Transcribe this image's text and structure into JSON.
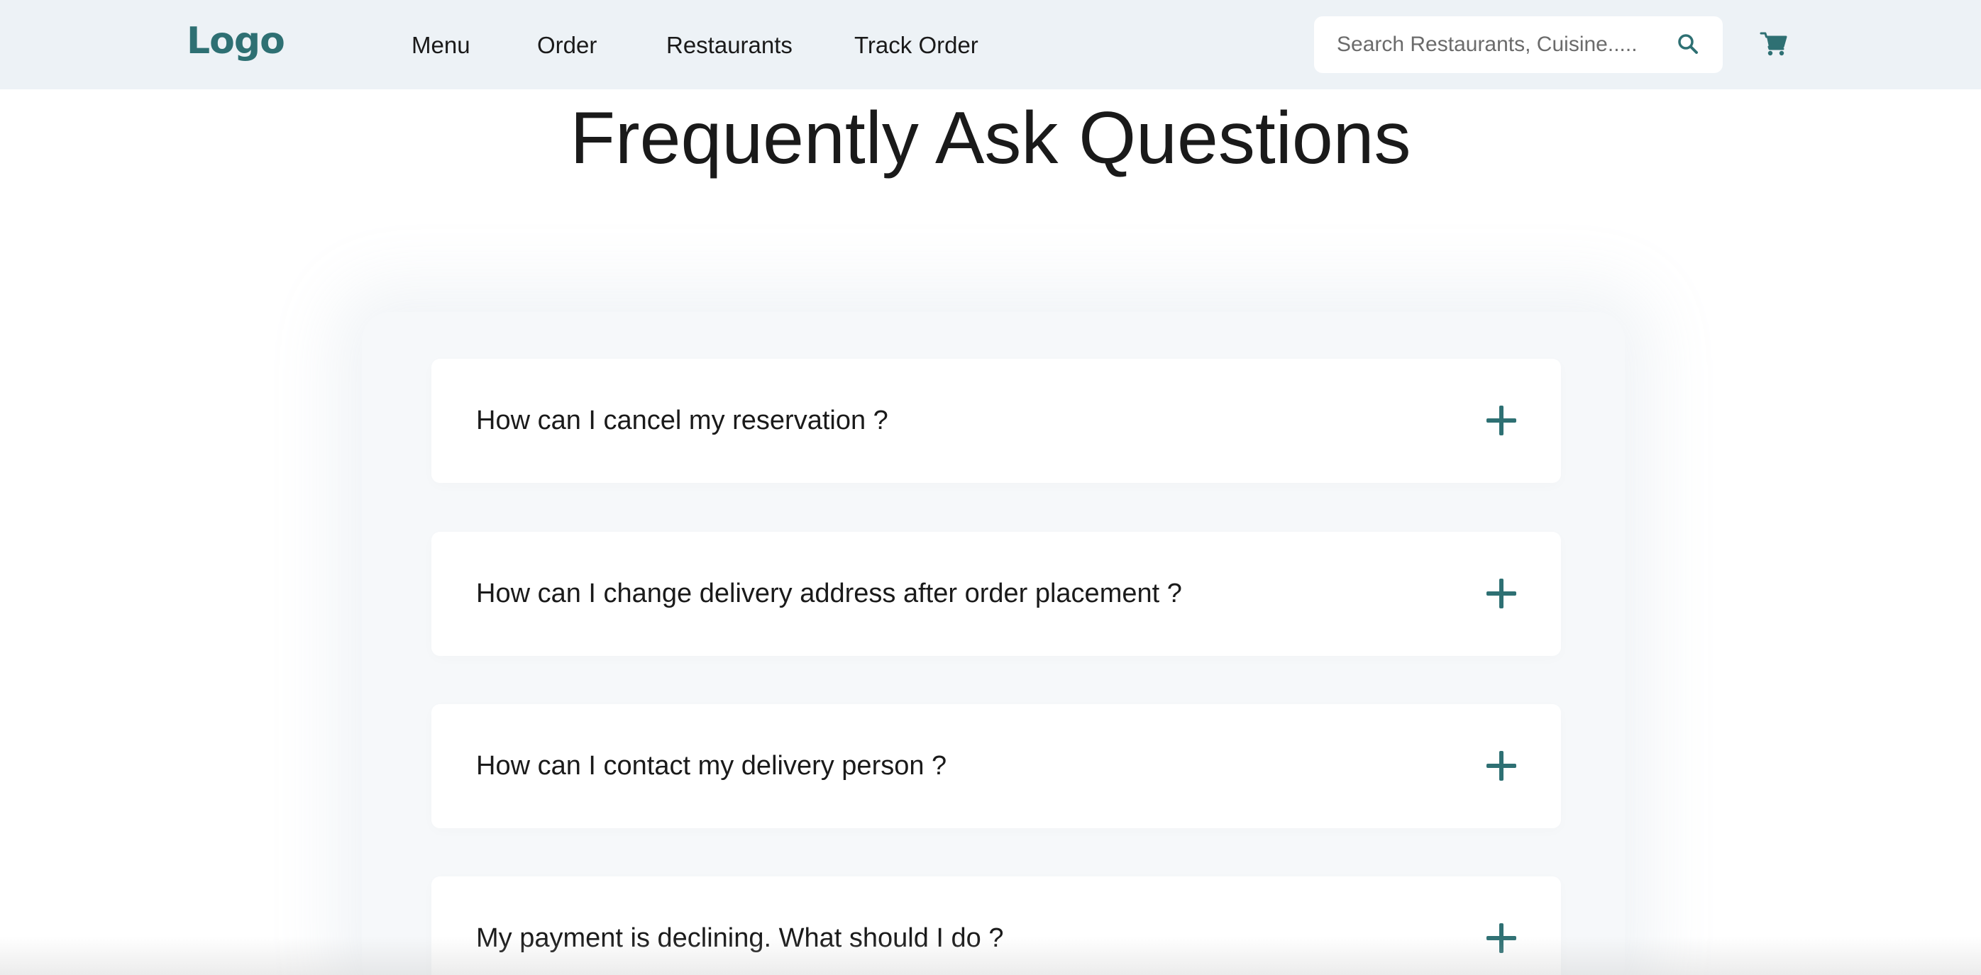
{
  "header": {
    "logo": "Logo",
    "nav": [
      {
        "label": "Menu"
      },
      {
        "label": "Order"
      },
      {
        "label": "Restaurants"
      },
      {
        "label": "Track Order"
      }
    ],
    "search": {
      "placeholder": "Search Restaurants, Cuisine.....",
      "value": ""
    },
    "icons": {
      "search": "search-icon",
      "cart": "cart-icon"
    }
  },
  "main": {
    "title": "Frequently Ask Questions",
    "faqs": [
      {
        "question": "How can I cancel my reservation ?",
        "expanded": false
      },
      {
        "question": "How can I change delivery address after order placement ?",
        "expanded": false
      },
      {
        "question": "How can I contact my delivery person ?",
        "expanded": false
      },
      {
        "question": "My payment is declining. What should I do ?",
        "expanded": false
      }
    ]
  },
  "colors": {
    "accent": "#2e7073",
    "header_bg": "#edf2f6",
    "text": "#1a1a1a"
  }
}
